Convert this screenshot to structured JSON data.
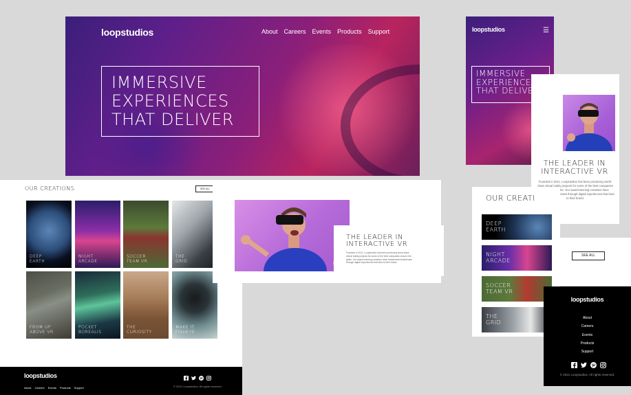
{
  "brand": {
    "logo": "loopstudios"
  },
  "nav": [
    "About",
    "Careers",
    "Events",
    "Products",
    "Support"
  ],
  "hero": {
    "headline_lines": [
      "IMMERSIVE",
      "EXPERIENCES",
      "THAT DELIVER"
    ]
  },
  "leader": {
    "title_lines": [
      "THE LEADER IN",
      "INTERACTIVE VR"
    ],
    "text": "Founded in 2011, Loopstudios has been producing world-class virtual reality projects for some of the best companies around the globe. Our award-winning creations have transformed businesses through digital experiences that bind to their brand."
  },
  "creations": {
    "title": "OUR CREATIONS",
    "mobile_title": "OUR CREATI",
    "see_all": "SEE ALL",
    "items": [
      {
        "label_lines": [
          "DEEP",
          "EARTH"
        ]
      },
      {
        "label_lines": [
          "NIGHT",
          "ARCADE"
        ]
      },
      {
        "label_lines": [
          "SOCCER",
          "TEAM VR"
        ]
      },
      {
        "label_lines": [
          "THE",
          "GRID"
        ]
      },
      {
        "label_lines": [
          "FROM UP",
          "ABOVE VR"
        ]
      },
      {
        "label_lines": [
          "POCKET",
          "BOREALIS"
        ]
      },
      {
        "label_lines": [
          "THE",
          "CURIOSITY"
        ]
      },
      {
        "label_lines": [
          "MAKE IT",
          "FISHEYE"
        ]
      }
    ]
  },
  "footer": {
    "copyright": "© 2021 Loopstudios. All rights reserved.",
    "social_icons": [
      "facebook-icon",
      "twitter-icon",
      "pinterest-icon",
      "instagram-icon"
    ]
  },
  "colors": {
    "black": "#000000",
    "white": "#ffffff",
    "hero_purple": "#5e1f8a",
    "hero_magenta": "#b8245f"
  }
}
